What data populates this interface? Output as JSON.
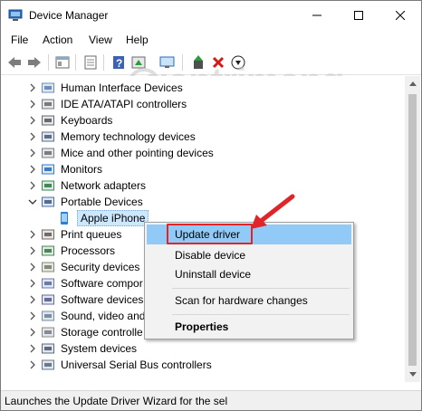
{
  "window": {
    "title": "Device Manager"
  },
  "menu": {
    "items": [
      "File",
      "Action",
      "View",
      "Help"
    ]
  },
  "toolbar": {
    "buttons": [
      "back-icon",
      "forward-icon",
      "show-hide-console-tree-icon",
      "properties-icon",
      "help-icon",
      "update-driver-toolbar-icon",
      "scan-hardware-icon",
      "enable-device-icon",
      "uninstall-device-icon",
      "download-icon"
    ]
  },
  "tree": {
    "items": [
      {
        "label": "Human Interface Devices",
        "expanded": false
      },
      {
        "label": "IDE ATA/ATAPI controllers",
        "expanded": false
      },
      {
        "label": "Keyboards",
        "expanded": false
      },
      {
        "label": "Memory technology devices",
        "expanded": false
      },
      {
        "label": "Mice and other pointing devices",
        "expanded": false
      },
      {
        "label": "Monitors",
        "expanded": false
      },
      {
        "label": "Network adapters",
        "expanded": false
      },
      {
        "label": "Portable Devices",
        "expanded": true
      },
      {
        "label": "Apple iPhone",
        "child": true,
        "selected": true
      },
      {
        "label": "Print queues",
        "expanded": false
      },
      {
        "label": "Processors",
        "expanded": false
      },
      {
        "label": "Security devices",
        "expanded": false
      },
      {
        "label": "Software compor",
        "expanded": false
      },
      {
        "label": "Software devices",
        "expanded": false
      },
      {
        "label": "Sound, video and",
        "expanded": false
      },
      {
        "label": "Storage controlle",
        "expanded": false
      },
      {
        "label": "System devices",
        "expanded": false
      },
      {
        "label": "Universal Serial Bus controllers",
        "expanded": false
      }
    ]
  },
  "context_menu": {
    "items": [
      {
        "label": "Update driver",
        "highlighted": true
      },
      {
        "label": "Disable device"
      },
      {
        "label": "Uninstall device"
      },
      {
        "label": "Scan for hardware changes"
      },
      {
        "label": "Properties",
        "bold": true
      }
    ]
  },
  "status": {
    "text": "Launches the Update Driver Wizard for the sel"
  },
  "watermark": {
    "text": "uantrimang"
  },
  "colors": {
    "highlight": "#91c9f7",
    "annotation": "#e0242a",
    "selection": "#cce8ff"
  }
}
